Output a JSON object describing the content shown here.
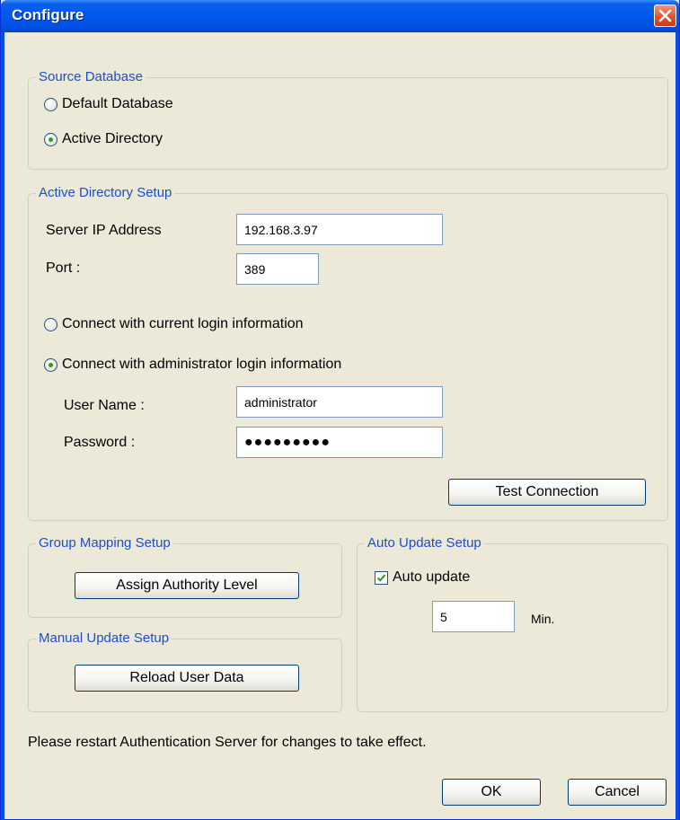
{
  "window": {
    "title": "Configure"
  },
  "source_database": {
    "legend": "Source Database",
    "options": [
      "Default Database",
      "Active Directory"
    ],
    "selected": "Active Directory"
  },
  "ad_setup": {
    "legend": "Active Directory Setup",
    "server_ip_label": "Server IP Address",
    "server_ip_value": "192.168.3.97",
    "port_label": "Port :",
    "port_value": "389",
    "connect_current_label": "Connect with current login information",
    "connect_admin_label": "Connect with administrator login information",
    "connect_selected": "Connect with administrator login information",
    "username_label": "User Name :",
    "username_value": "administrator",
    "password_label": "Password :",
    "password_value": "●●●●●●●●●",
    "test_connection_label": "Test Connection"
  },
  "group_mapping": {
    "legend": "Group Mapping Setup",
    "assign_button": "Assign Authority Level"
  },
  "manual_update": {
    "legend": "Manual Update Setup",
    "reload_button": "Reload User Data"
  },
  "auto_update": {
    "legend": "Auto Update Setup",
    "checkbox_label": "Auto update",
    "checked": true,
    "interval_value": "5",
    "interval_unit": "Min."
  },
  "footer": {
    "notice": "Please restart Authentication Server for changes to take effect.",
    "ok_label": "OK",
    "cancel_label": "Cancel"
  },
  "colors": {
    "titlebar": "#0058ee",
    "dialog_bg": "#ece9d8",
    "legend_text": "#1c4ecb",
    "close_button": "#e3522f",
    "radio_selected_dot": "#21a121"
  }
}
